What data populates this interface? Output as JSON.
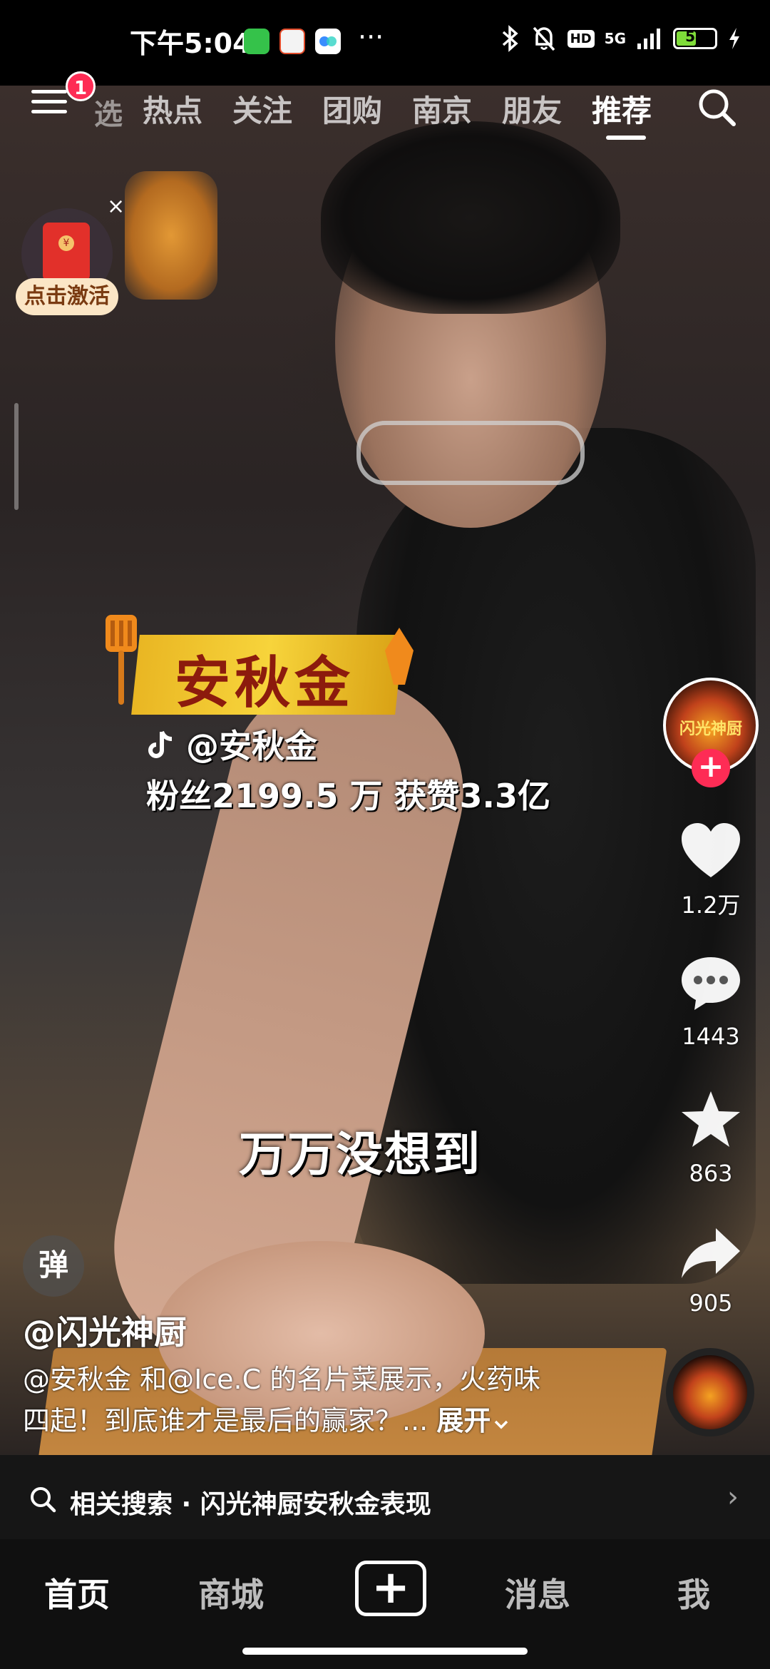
{
  "status_bar": {
    "time": "下午5:04",
    "app_icons": [
      "wechat-icon",
      "58-app-icon",
      "baidu-netdisk-icon"
    ],
    "more": "···",
    "network": "5G",
    "hd": "HD",
    "battery": "54",
    "battery_percent": 54
  },
  "top_nav": {
    "menu_badge": "1",
    "truncated_tab": "选",
    "tabs": [
      "热点",
      "关注",
      "团购",
      "南京",
      "朋友",
      "推荐"
    ],
    "active_tab": "推荐"
  },
  "red_packet": {
    "close": "×",
    "label": "点击激活"
  },
  "overlay": {
    "name_plate": "安秋金",
    "tiktok_handle": "@安秋金",
    "fans_line": "粉丝2199.5 万 获赞3.3亿",
    "subtitle": "万万没想到"
  },
  "sidebar": {
    "avatar_text": "闪光神厨",
    "follow": "+",
    "likes": "1.2万",
    "comments": "1443",
    "favorites": "863",
    "shares": "905"
  },
  "info": {
    "danmaku": "弹",
    "author": "@闪光神厨",
    "description_line1": "@安秋金 和@Ice.C 的名片菜展示，火药味",
    "description_line2": "四起！到底谁才是最后的赢家？...",
    "expand": "展开"
  },
  "related_search": {
    "text": "相关搜索 · 闪光神厨安秋金表现",
    "arrow": "›"
  },
  "bottom_nav": {
    "home": "首页",
    "mall": "商城",
    "plus": "+",
    "messages": "消息",
    "me": "我",
    "active": "首页"
  },
  "colors": {
    "accent": "#fe2c55",
    "battery": "#7fdc39",
    "name_plate": "#f7d43b",
    "name_text": "#8c1b0d"
  }
}
